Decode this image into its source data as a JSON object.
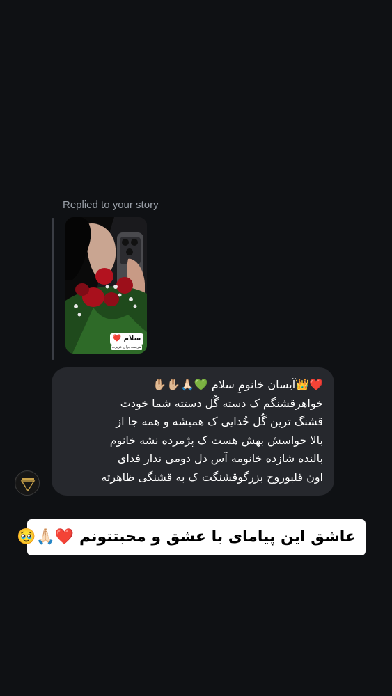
{
  "reply_header": {
    "text": "Replied to your story"
  },
  "story_preview": {
    "sticker_text": "سلام ❤️",
    "sticker_subtext": "بفرست برای عزیزت"
  },
  "message": {
    "lines": [
      "❤️👑آیسان خانومِ سلام 💚🙏🏻✋🏼✋🏼",
      "خواهرقشنگم ک دسته گُل دستته شما خودت",
      "قشنگ ترین گُل خُدایی ک همیشه و همه جا از",
      "بالا حواسش بهش هست ک پژمرده نشه خانوم",
      "بالنده شازده خانومه آس دل دومی ندار فدای",
      "اون قلبوروح بزرگوقشنگت ک به قشنگی ظاهرته"
    ]
  },
  "caption": {
    "text": "عاشق این پیامای با عشق و محبتتونم ❤️🙏🏻🥹"
  },
  "colors": {
    "background": "#0f1114",
    "bubble": "#26282d",
    "reply_label": "#9aa0a8",
    "caption_bg": "#ffffff"
  }
}
